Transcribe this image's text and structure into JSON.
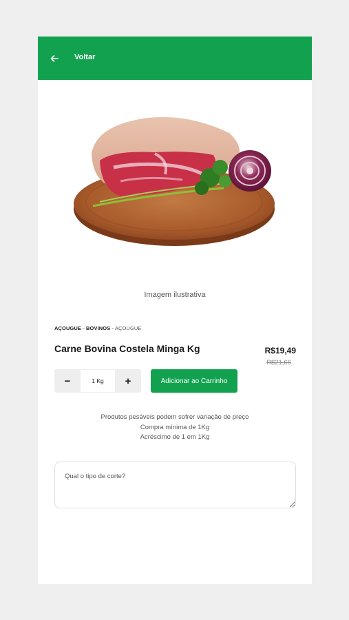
{
  "header": {
    "back_icon": "arrow-left-icon",
    "back_label": "Voltar",
    "color": "#12a24f"
  },
  "image": {
    "caption": "Imagem ilustrativa"
  },
  "breadcrumb": {
    "items": [
      "AÇOUGUE",
      "BOVINOS",
      "AÇOUGUE"
    ],
    "separator": " - "
  },
  "product": {
    "title": "Carne Bovina Costela Minga Kg",
    "price": "R$19,49",
    "old_price": "R$21,66"
  },
  "quantity": {
    "minus_label": "−",
    "value": "1 Kg",
    "plus_label": "+"
  },
  "cart": {
    "add_label": "Adicionar ao Carrinho"
  },
  "notes": {
    "line1": "Produtos pesáveis podem sofrer variação de preço",
    "line2": "Compra mínima de 1Kg",
    "line3": "Acréscimo de 1 em 1Kg"
  },
  "cut_field": {
    "placeholder": "Qual o tipo de corte?",
    "value": ""
  }
}
